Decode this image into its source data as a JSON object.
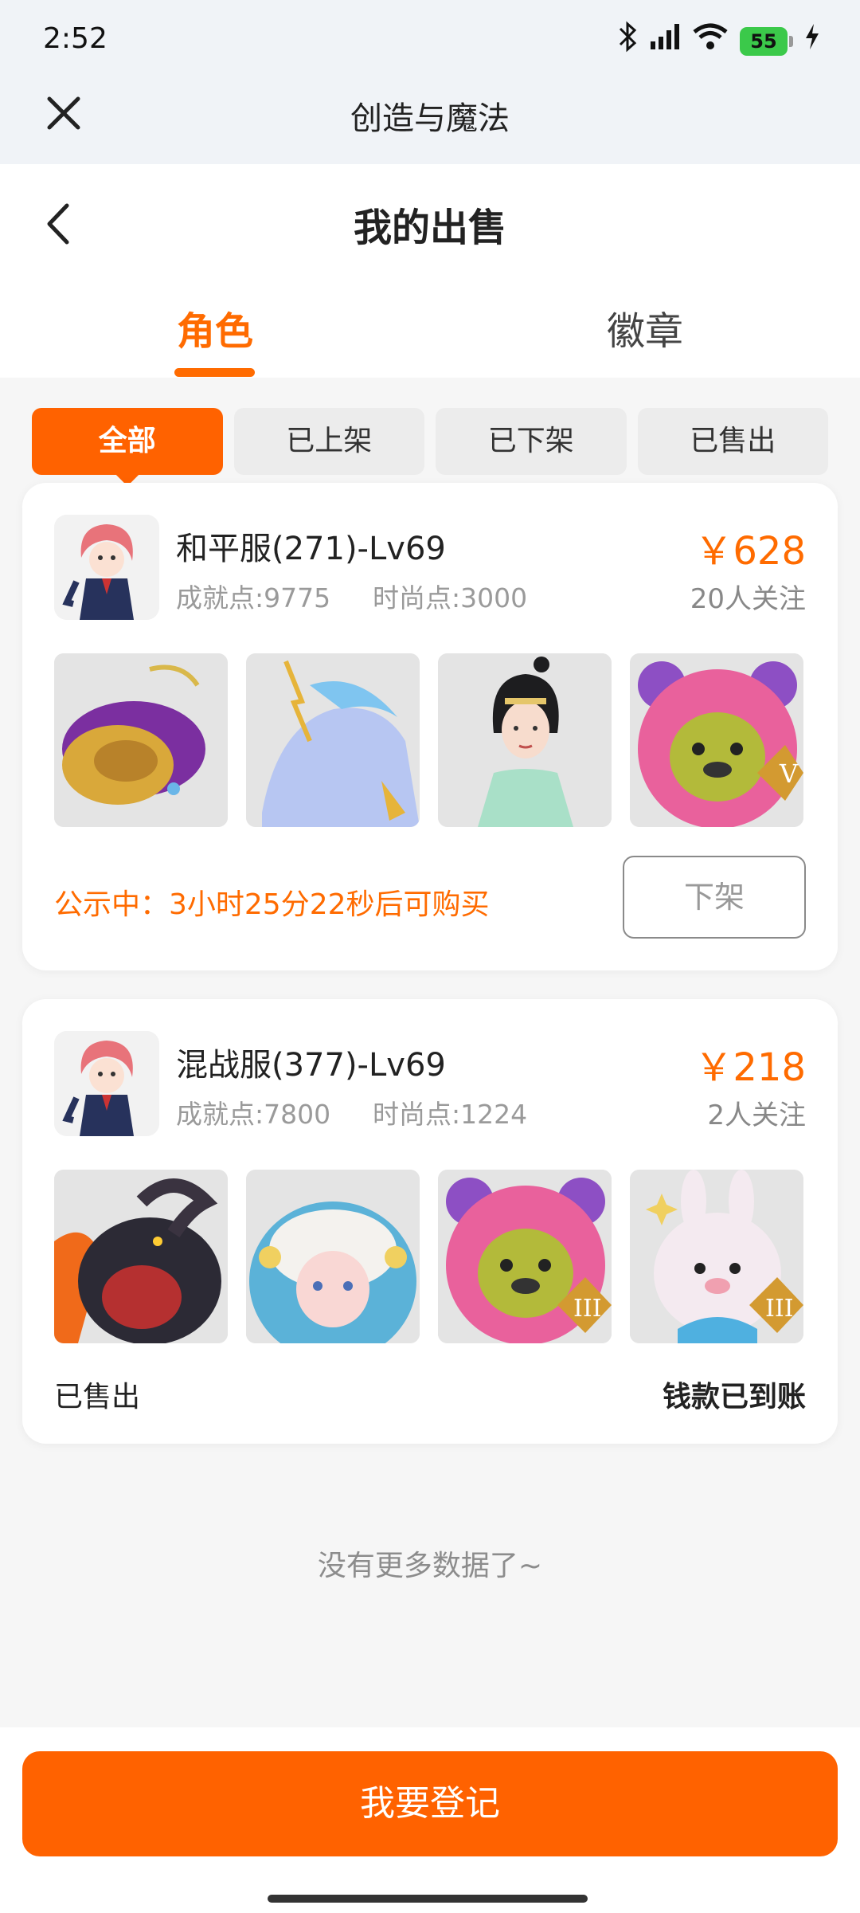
{
  "status_bar": {
    "time": "2:52",
    "battery": "55"
  },
  "webview": {
    "title": "创造与魔法"
  },
  "header": {
    "title": "我的出售"
  },
  "tabs": [
    {
      "label": "角色",
      "active": true
    },
    {
      "label": "徽章",
      "active": false
    }
  ],
  "filters": [
    {
      "label": "全部",
      "active": true
    },
    {
      "label": "已上架",
      "active": false
    },
    {
      "label": "已下架",
      "active": false
    },
    {
      "label": "已售出",
      "active": false
    }
  ],
  "listings": [
    {
      "title": "和平服(271)-Lv69",
      "achievement": "成就点:9775",
      "fashion": "时尚点:3000",
      "price": "￥628",
      "watchers": "20人关注",
      "thumbnails": [
        "golden-mount",
        "ice-horse-mount",
        "chinese-dress-outfit",
        "pink-bear-costume"
      ],
      "notice": "公示中：3小时25分22秒后可购买",
      "action": "下架"
    },
    {
      "title": "混战服(377)-Lv69",
      "achievement": "成就点:7800",
      "fashion": "时尚点:1224",
      "price": "￥218",
      "watchers": "2人关注",
      "thumbnails": [
        "black-goat-beast",
        "sheep-hood-costume",
        "pink-bear-costume",
        "white-rabbit-costume"
      ],
      "status": "已售出",
      "payment": "钱款已到账"
    }
  ],
  "footer": {
    "no_more": "没有更多数据了~",
    "register_button": "我要登记"
  },
  "colors": {
    "accent": "#ff6200",
    "price": "#ff6b00",
    "battery": "#3bc94a"
  }
}
